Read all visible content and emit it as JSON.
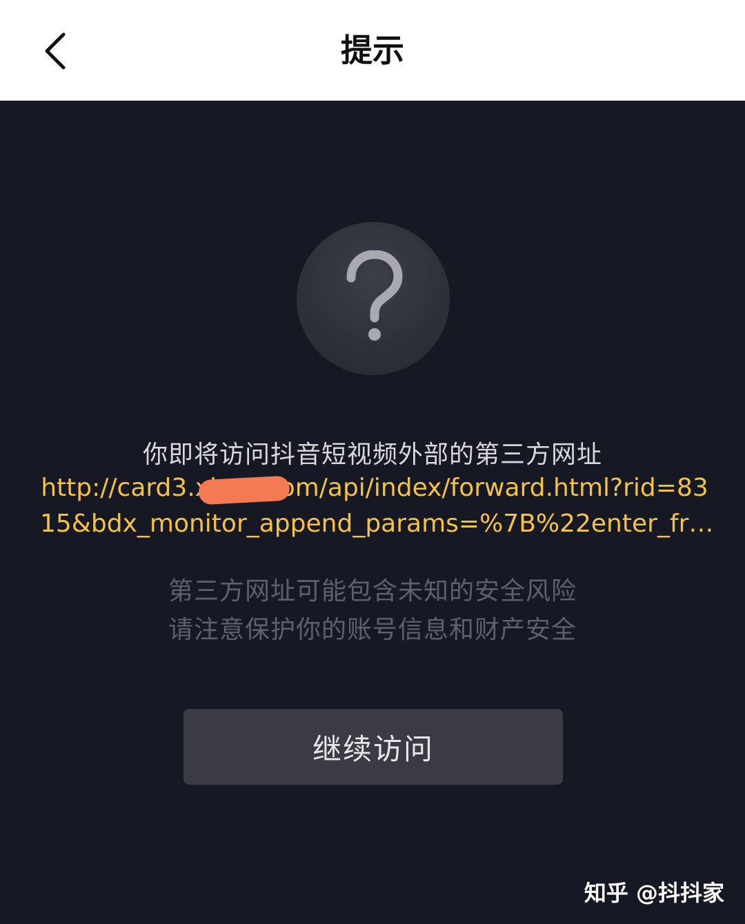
{
  "header": {
    "title": "提示",
    "back_icon": "chevron-left-icon"
  },
  "main": {
    "icon": "question-mark-icon",
    "notice": "你即将访问抖音短视频外部的第三方网址",
    "url_line1": "http://card3.xl-------om/api/index/forward.html?rid=83",
    "url_line2": "15&bdx_monitor_append_params=%7B%22enter_fr…",
    "warning_line1": "第三方网址可能包含未知的安全风险",
    "warning_line2": "请注意保护你的账号信息和财产安全",
    "continue_label": "继续访问"
  },
  "watermark": "知乎 @抖抖家",
  "colors": {
    "background": "#161824",
    "url": "#f5c342",
    "redaction": "#f47a54",
    "button": "#3a3b45"
  }
}
